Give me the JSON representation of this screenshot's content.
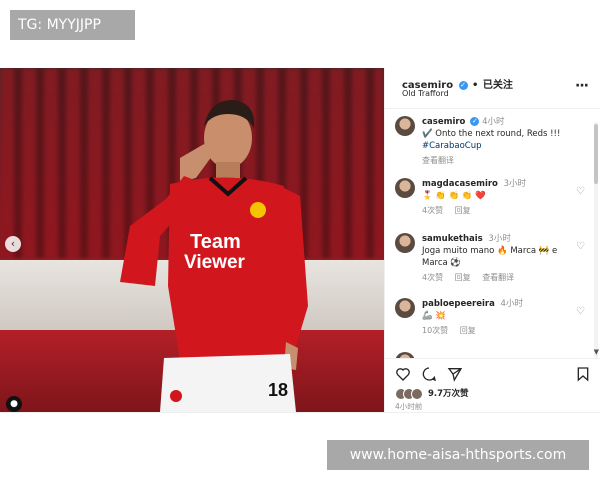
{
  "watermarks": {
    "top": "TG: MYYJJPP",
    "bottom": "www.home-aisa-hthsports.com"
  },
  "post": {
    "username": "casemiro",
    "separator": "•",
    "follow_status": "已关注",
    "location": "Old Trafford",
    "shirt_sponsor": "Team\nViewer",
    "shirt_number": "18",
    "caption": {
      "username": "casemiro",
      "time": "4小时",
      "text": "✔️ Onto the next round, Reds !!!",
      "hashtag": "#CarabaoCup",
      "translate": "查看翻译"
    },
    "comments": [
      {
        "username": "magdacasemiro",
        "time": "3小时",
        "text": "🎖️ 👏 👏 👏 ❤️",
        "likes": "4次赞",
        "reply": "回复",
        "translate": ""
      },
      {
        "username": "samukethais",
        "time": "3小时",
        "text": "Joga muito mano 🔥 Marca 🚧 e Marca ⚽",
        "likes": "4次赞",
        "reply": "回复",
        "translate": "查看翻译"
      },
      {
        "username": "pabloepeereira",
        "time": "4小时",
        "text": "🦾 💥",
        "likes": "10次赞",
        "reply": "回复",
        "translate": ""
      }
    ],
    "likes_count": "9.7万次赞",
    "posted_time": "4小时前"
  },
  "colors": {
    "verified": "#3897f0",
    "link": "#00376b",
    "muted": "#8e8e8e",
    "kit_red": "#d2161e"
  }
}
